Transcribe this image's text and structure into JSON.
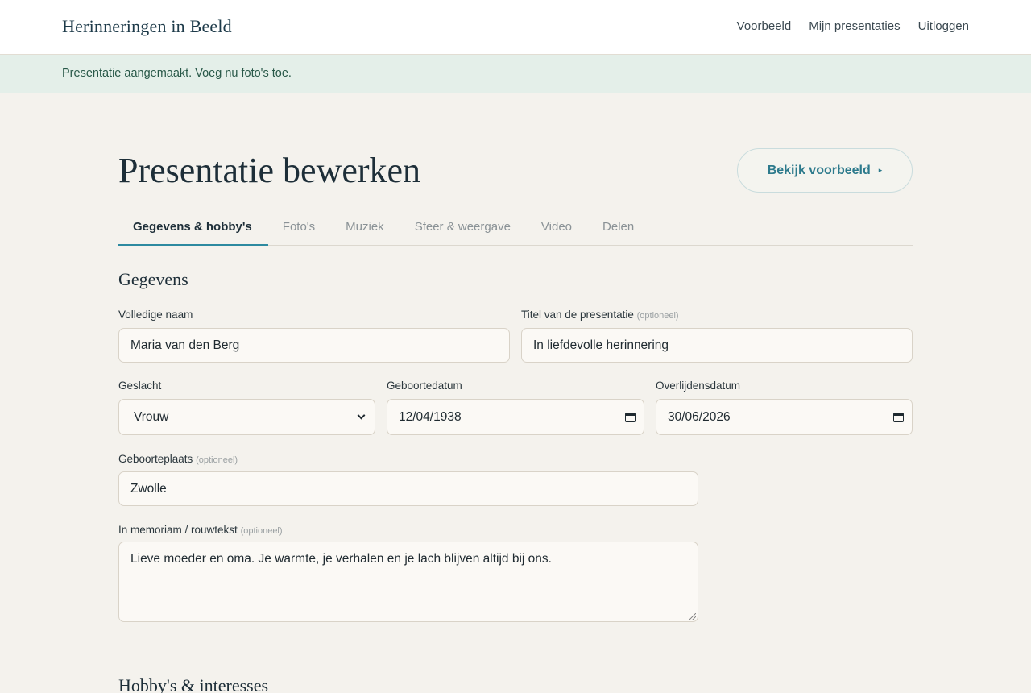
{
  "header": {
    "brand": "Herinneringen in Beeld",
    "nav": [
      "Voorbeeld",
      "Mijn presentaties",
      "Uitloggen"
    ]
  },
  "flash": {
    "message": "Presentatie aangemaakt. Voeg nu foto's toe."
  },
  "page": {
    "title": "Presentatie bewerken",
    "preview_button": "Bekijk voorbeeld",
    "preview_arrow": "▸"
  },
  "tabs": [
    {
      "label": "Gegevens & hobby's",
      "active": true
    },
    {
      "label": "Foto's",
      "active": false
    },
    {
      "label": "Muziek",
      "active": false
    },
    {
      "label": "Sfeer & weergave",
      "active": false
    },
    {
      "label": "Video",
      "active": false
    },
    {
      "label": "Delen",
      "active": false
    }
  ],
  "gegevens": {
    "title": "Gegevens",
    "optional_hint": "(optioneel)",
    "full_name": {
      "label": "Volledige naam",
      "value": "Maria van den Berg"
    },
    "presentation_title": {
      "label": "Titel van de presentatie",
      "value": "In liefdevolle herinnering"
    },
    "gender": {
      "label": "Geslacht",
      "value": "Vrouw"
    },
    "birth_date": {
      "label": "Geboortedatum",
      "value": "12/04/1938"
    },
    "death_date": {
      "label": "Overlijdensdatum",
      "value": "30/06/2026"
    },
    "birth_place": {
      "label": "Geboorteplaats",
      "value": "Zwolle"
    },
    "memoriam": {
      "label": "In memoriam / rouwtekst",
      "value": "Lieve moeder en oma. Je warmte, je verhalen en je lach blijven altijd bij ons."
    }
  },
  "hobbies": {
    "title": "Hobby's & interesses"
  }
}
